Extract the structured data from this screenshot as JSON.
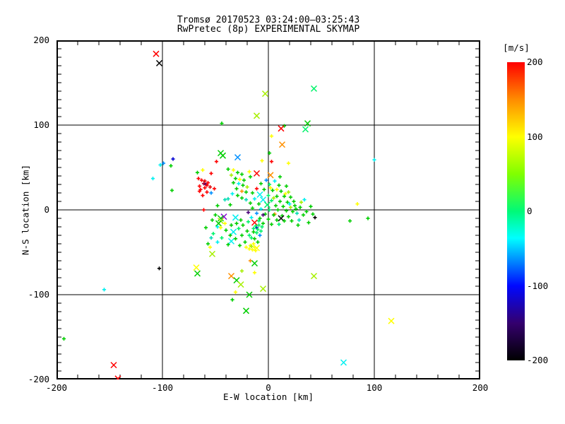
{
  "title": {
    "line1": "Tromsø 20170523 03:24:00–03:25:43",
    "line2": "RwPretec (8p) EXPERIMENTAL SKYMAP"
  },
  "axes": {
    "x_label": "E-W location [km]",
    "y_label": "N-S location [km]",
    "x_ticks": [
      "-200",
      "-100",
      "0",
      "100",
      "200"
    ],
    "y_ticks": [
      "200",
      "100",
      "0",
      "-100",
      "-200"
    ]
  },
  "colorbar": {
    "title": "[m/s]",
    "tick_labels": [
      "200",
      "100",
      "0",
      "-100",
      "-200"
    ],
    "min": -200,
    "max": 200,
    "stops": [
      {
        "pos": 0,
        "color": "#FF0000"
      },
      {
        "pos": 12.5,
        "color": "#FF8C00"
      },
      {
        "pos": 25,
        "color": "#FFFF00"
      },
      {
        "pos": 37.5,
        "color": "#80FF00"
      },
      {
        "pos": 50,
        "color": "#00FA78"
      },
      {
        "pos": 59,
        "color": "#00FFFF"
      },
      {
        "pos": 75,
        "color": "#0008FF"
      },
      {
        "pos": 87.5,
        "color": "#34006E"
      },
      {
        "pos": 100,
        "color": "#000000"
      }
    ]
  },
  "chart_data": {
    "type": "scatter",
    "title": "Tromsø 20170523 03:24:00–03:25:43 / RwPretec (8p) EXPERIMENTAL SKYMAP",
    "xlabel": "E-W location [km]",
    "ylabel": "N-S location [km]",
    "xlim": [
      -200,
      200
    ],
    "ylim": [
      -200,
      200
    ],
    "x_minor_tick": 20,
    "y_minor_tick": 10,
    "gridlines": [
      -100,
      0,
      100
    ],
    "grid": "on",
    "legend_position": "right-colorbar",
    "color_units": "m/s",
    "palette": {
      "red": "#FF0000",
      "crimson": "#E00000",
      "maroon": "#A8002E",
      "orange": "#FF9000",
      "yellow": "#FFFF00",
      "chartreuse": "#A6F000",
      "green": "#00CE00",
      "spring": "#00F36A",
      "teal": "#00DCB4",
      "cyan": "#00F0F0",
      "skyblue": "#0090FF",
      "navy": "#0000D2",
      "purple": "#8800D8",
      "darkpurple": "#48007A",
      "black": "#000000"
    },
    "marker_legend": {
      "p": "small plus",
      "x": "large cross"
    },
    "points": [
      [
        -106,
        184,
        "red",
        "x"
      ],
      [
        -103,
        173,
        "black",
        "x"
      ],
      [
        43,
        143,
        "spring",
        "x"
      ],
      [
        -3,
        137,
        "chartreuse",
        "x"
      ],
      [
        -11,
        111,
        "chartreuse",
        "x"
      ],
      [
        -44,
        102,
        "green",
        "p"
      ],
      [
        37,
        102,
        "green",
        "x"
      ],
      [
        15,
        99,
        "green",
        "p"
      ],
      [
        12,
        96,
        "red",
        "x"
      ],
      [
        35,
        95,
        "spring",
        "x"
      ],
      [
        3,
        87,
        "yellow",
        "p"
      ],
      [
        13,
        77,
        "orange",
        "x"
      ],
      [
        100,
        59,
        "cyan",
        "p"
      ],
      [
        84,
        7,
        "yellow",
        "p"
      ],
      [
        94,
        -10,
        "green",
        "p"
      ],
      [
        77,
        -13,
        "green",
        "p"
      ],
      [
        44,
        -9,
        "black",
        "p"
      ],
      [
        -155,
        -94,
        "cyan",
        "p"
      ],
      [
        -193,
        -152,
        "green",
        "p"
      ],
      [
        -146,
        -183,
        "red",
        "x"
      ],
      [
        -142,
        -199,
        "red",
        "x"
      ],
      [
        43,
        -78,
        "chartreuse",
        "x"
      ],
      [
        116,
        -131,
        "yellow",
        "x"
      ],
      [
        71,
        -180,
        "cyan",
        "x"
      ],
      [
        -103,
        -69,
        "black",
        "p"
      ],
      [
        -45,
        67,
        "green",
        "x"
      ],
      [
        -90,
        60,
        "navy",
        "p"
      ],
      [
        -102,
        53,
        "cyan",
        "p"
      ],
      [
        -99,
        55,
        "skyblue",
        "p"
      ],
      [
        -92,
        52,
        "green",
        "p"
      ],
      [
        -109,
        37,
        "cyan",
        "p"
      ],
      [
        -91,
        23,
        "green",
        "p"
      ],
      [
        -49,
        57,
        "red",
        "p"
      ],
      [
        -43,
        64,
        "green",
        "x"
      ],
      [
        -29,
        62,
        "skyblue",
        "x"
      ],
      [
        -62,
        47,
        "yellow",
        "p"
      ],
      [
        -67,
        44,
        "green",
        "p"
      ],
      [
        -54,
        43,
        "red",
        "p"
      ],
      [
        -66,
        37,
        "red",
        "p"
      ],
      [
        -63,
        35,
        "red",
        "p"
      ],
      [
        -60,
        34,
        "crimson",
        "p"
      ],
      [
        -57,
        32,
        "red",
        "p"
      ],
      [
        -61,
        31,
        "maroon",
        "p"
      ],
      [
        -59,
        30,
        "darkpurple",
        "p"
      ],
      [
        -58,
        29,
        "red",
        "p"
      ],
      [
        -65,
        28,
        "red",
        "p"
      ],
      [
        -55,
        27,
        "crimson",
        "p"
      ],
      [
        -60,
        26,
        "red",
        "p"
      ],
      [
        -51,
        25,
        "red",
        "p"
      ],
      [
        -64,
        24,
        "red",
        "p"
      ],
      [
        -65,
        22,
        "red",
        "p"
      ],
      [
        -58,
        21,
        "red",
        "p"
      ],
      [
        -54,
        20,
        "skyblue",
        "p"
      ],
      [
        -62,
        17,
        "red",
        "p"
      ],
      [
        -38,
        48,
        "green",
        "p"
      ],
      [
        -33,
        47,
        "yellow",
        "p"
      ],
      [
        -18,
        45,
        "yellow",
        "p"
      ],
      [
        -29,
        44,
        "green",
        "p"
      ],
      [
        -11,
        43,
        "red",
        "x"
      ],
      [
        -25,
        42,
        "green",
        "p"
      ],
      [
        -35,
        41,
        "chartreuse",
        "p"
      ],
      [
        -17,
        39,
        "green",
        "p"
      ],
      [
        -31,
        37,
        "green",
        "p"
      ],
      [
        -27,
        36,
        "yellow",
        "p"
      ],
      [
        -23,
        35,
        "green",
        "p"
      ],
      [
        -33,
        32,
        "green",
        "p"
      ],
      [
        -28,
        31,
        "cyan",
        "p"
      ],
      [
        -24,
        29,
        "green",
        "p"
      ],
      [
        -20,
        27,
        "chartreuse",
        "p"
      ],
      [
        -30,
        25,
        "green",
        "p"
      ],
      [
        -25,
        22,
        "orange",
        "p"
      ],
      [
        -21,
        21,
        "green",
        "p"
      ],
      [
        -34,
        19,
        "cyan",
        "p"
      ],
      [
        -29,
        17,
        "green",
        "p"
      ],
      [
        -25,
        14,
        "green",
        "p"
      ],
      [
        -21,
        12,
        "teal",
        "p"
      ],
      [
        -41,
        12,
        "teal",
        "p"
      ],
      [
        -38,
        13,
        "teal",
        "p"
      ],
      [
        -6,
        58,
        "yellow",
        "p"
      ],
      [
        3,
        57,
        "red",
        "p"
      ],
      [
        19,
        55,
        "yellow",
        "p"
      ],
      [
        1,
        67,
        "green",
        "p"
      ],
      [
        2,
        41,
        "orange",
        "x"
      ],
      [
        11,
        39,
        "green",
        "p"
      ],
      [
        -2,
        35,
        "skyblue",
        "p"
      ],
      [
        6,
        34,
        "cyan",
        "p"
      ],
      [
        -7,
        31,
        "green",
        "p"
      ],
      [
        1,
        30,
        "spring",
        "p"
      ],
      [
        10,
        29,
        "green",
        "p"
      ],
      [
        17,
        28,
        "green",
        "p"
      ],
      [
        2,
        26,
        "yellow",
        "p"
      ],
      [
        -11,
        25,
        "red",
        "p"
      ],
      [
        -4,
        24,
        "green",
        "p"
      ],
      [
        8,
        24,
        "yellow",
        "p"
      ],
      [
        4,
        23,
        "green",
        "p"
      ],
      [
        12,
        22,
        "green",
        "p"
      ],
      [
        19,
        21,
        "chartreuse",
        "p"
      ],
      [
        -15,
        20,
        "green",
        "p"
      ],
      [
        16,
        19,
        "yellow",
        "p"
      ],
      [
        -8,
        18,
        "cyan",
        "x"
      ],
      [
        0,
        17,
        "spring",
        "p"
      ],
      [
        8,
        16,
        "green",
        "p"
      ],
      [
        15,
        16,
        "green",
        "p"
      ],
      [
        21,
        15,
        "green",
        "p"
      ],
      [
        5,
        14,
        "chartreuse",
        "p"
      ],
      [
        -13,
        13,
        "cyan",
        "p"
      ],
      [
        -5,
        12,
        "cyan",
        "x"
      ],
      [
        3,
        11,
        "spring",
        "p"
      ],
      [
        11,
        10,
        "green",
        "p"
      ],
      [
        24,
        10,
        "green",
        "p"
      ],
      [
        18,
        9,
        "green",
        "p"
      ],
      [
        31,
        9,
        "chartreuse",
        "p"
      ],
      [
        -17,
        8,
        "green",
        "p"
      ],
      [
        -9,
        7,
        "green",
        "p"
      ],
      [
        20,
        7,
        "cyan",
        "p"
      ],
      [
        -1,
        6,
        "spring",
        "x"
      ],
      [
        7,
        5,
        "green",
        "p"
      ],
      [
        25,
        5,
        "green",
        "p"
      ],
      [
        14,
        4,
        "green",
        "p"
      ],
      [
        40,
        4,
        "green",
        "p"
      ],
      [
        21,
        3,
        "chartreuse",
        "p"
      ],
      [
        30,
        3,
        "green",
        "p"
      ],
      [
        -15,
        2,
        "green",
        "p"
      ],
      [
        26,
        1,
        "green",
        "p"
      ],
      [
        -7,
        1,
        "cyan",
        "p"
      ],
      [
        1,
        0,
        "spring",
        "p"
      ],
      [
        9,
        0,
        "green",
        "p"
      ],
      [
        17,
        -1,
        "green",
        "p"
      ],
      [
        23,
        -2,
        "green",
        "p"
      ],
      [
        36,
        -2,
        "green",
        "p"
      ],
      [
        -19,
        -3,
        "darkpurple",
        "p"
      ],
      [
        -11,
        -4,
        "skyblue",
        "p"
      ],
      [
        27,
        -4,
        "teal",
        "p"
      ],
      [
        -3,
        -5,
        "green",
        "p"
      ],
      [
        6,
        -5,
        "orange",
        "p"
      ],
      [
        42,
        -5,
        "green",
        "p"
      ],
      [
        5,
        -6,
        "green",
        "p"
      ],
      [
        -5,
        -6,
        "darkpurple",
        "p"
      ],
      [
        33,
        -6,
        "green",
        "p"
      ],
      [
        13,
        -7,
        "green",
        "p"
      ],
      [
        19,
        -8,
        "green",
        "p"
      ],
      [
        -16,
        -9,
        "cyan",
        "p"
      ],
      [
        -8,
        -10,
        "green",
        "p"
      ],
      [
        12,
        -10,
        "black",
        "x"
      ],
      [
        0,
        -11,
        "green",
        "p"
      ],
      [
        8,
        -12,
        "green",
        "p"
      ],
      [
        29,
        -12,
        "teal",
        "p"
      ],
      [
        15,
        -13,
        "green",
        "p"
      ],
      [
        22,
        -13,
        "green",
        "p"
      ],
      [
        -13,
        -15,
        "red",
        "x"
      ],
      [
        34,
        12,
        "cyan",
        "p"
      ],
      [
        -5,
        -16,
        "green",
        "p"
      ],
      [
        3,
        -17,
        "green",
        "p"
      ],
      [
        10,
        -17,
        "spring",
        "p"
      ],
      [
        38,
        -15,
        "green",
        "p"
      ],
      [
        28,
        -18,
        "green",
        "p"
      ],
      [
        -61,
        0,
        "red",
        "p"
      ],
      [
        -50,
        -6,
        "green",
        "p"
      ],
      [
        -48,
        5,
        "green",
        "p"
      ],
      [
        -36,
        6,
        "green",
        "p"
      ],
      [
        -42,
        -8,
        "purple",
        "x"
      ],
      [
        -31,
        -9,
        "cyan",
        "x"
      ],
      [
        -45,
        -10,
        "green",
        "x"
      ],
      [
        -53,
        -12,
        "green",
        "p"
      ],
      [
        -45,
        -13,
        "chartreuse",
        "x"
      ],
      [
        -47,
        -16,
        "green",
        "x"
      ],
      [
        -59,
        -21,
        "green",
        "p"
      ],
      [
        -45,
        -21,
        "yellow",
        "p"
      ],
      [
        -48,
        -20,
        "cyan",
        "p"
      ],
      [
        -41,
        -16,
        "yellow",
        "p"
      ],
      [
        -33,
        -26,
        "cyan",
        "x"
      ],
      [
        -35,
        -37,
        "cyan",
        "x"
      ],
      [
        -38,
        -41,
        "green",
        "p"
      ],
      [
        -54,
        -33,
        "teal",
        "p"
      ],
      [
        -48,
        -38,
        "cyan",
        "p"
      ],
      [
        -52,
        -28,
        "spring",
        "p"
      ],
      [
        -44,
        -33,
        "spring",
        "p"
      ],
      [
        -57,
        -40,
        "green",
        "p"
      ],
      [
        -55,
        -44,
        "yellow",
        "p"
      ],
      [
        -53,
        -52,
        "chartreuse",
        "x"
      ],
      [
        -68,
        -68,
        "yellow",
        "x"
      ],
      [
        -67,
        -75,
        "green",
        "x"
      ],
      [
        -30,
        -16,
        "green",
        "p"
      ],
      [
        -26,
        -12,
        "green",
        "p"
      ],
      [
        -24,
        -18,
        "green",
        "p"
      ],
      [
        -19,
        -14,
        "spring",
        "p"
      ],
      [
        -35,
        -18,
        "green",
        "p"
      ],
      [
        -40,
        -24,
        "green",
        "p"
      ],
      [
        -20,
        -25,
        "green",
        "p"
      ],
      [
        -28,
        -22,
        "spring",
        "p"
      ],
      [
        -25,
        -30,
        "green",
        "p"
      ],
      [
        -36,
        -30,
        "green",
        "p"
      ],
      [
        -31,
        -34,
        "green",
        "p"
      ],
      [
        -16,
        -33,
        "spring",
        "p"
      ],
      [
        -22,
        -38,
        "green",
        "p"
      ],
      [
        -14,
        -26,
        "green",
        "p"
      ],
      [
        -18,
        -30,
        "spring",
        "p"
      ],
      [
        -13,
        -34,
        "green",
        "p"
      ],
      [
        -10,
        -38,
        "green",
        "p"
      ],
      [
        -27,
        -42,
        "green",
        "p"
      ],
      [
        -11,
        -21,
        "navy",
        "p"
      ],
      [
        -8,
        -30,
        "skyblue",
        "p"
      ],
      [
        -9,
        -18,
        "spring",
        "p"
      ],
      [
        -12,
        -19,
        "spring",
        "p"
      ],
      [
        -10,
        -23,
        "spring",
        "p"
      ],
      [
        -7,
        -25,
        "spring",
        "p"
      ],
      [
        -14,
        -22,
        "spring",
        "p"
      ],
      [
        -11,
        -27,
        "spring",
        "p"
      ],
      [
        -9,
        -13,
        "spring",
        "p"
      ],
      [
        -6,
        -20,
        "spring",
        "p"
      ],
      [
        -21,
        -44,
        "yellow",
        "p"
      ],
      [
        -17,
        -42,
        "yellow",
        "p"
      ],
      [
        -13,
        -44,
        "yellow",
        "p"
      ],
      [
        -15,
        -47,
        "yellow",
        "p"
      ],
      [
        -18,
        -46,
        "yellow",
        "p"
      ],
      [
        -12,
        -48,
        "yellow",
        "p"
      ],
      [
        -16,
        -43,
        "chartreuse",
        "p"
      ],
      [
        -14,
        -40,
        "yellow",
        "p"
      ],
      [
        -11,
        -45,
        "yellow",
        "x"
      ],
      [
        -17,
        -60,
        "orange",
        "p"
      ],
      [
        -13,
        -63,
        "green",
        "x"
      ],
      [
        -25,
        -72,
        "chartreuse",
        "p"
      ],
      [
        -13,
        -74,
        "yellow",
        "p"
      ],
      [
        -35,
        -78,
        "orange",
        "x"
      ],
      [
        -30,
        -83,
        "green",
        "x"
      ],
      [
        -26,
        -88,
        "chartreuse",
        "x"
      ],
      [
        -5,
        -93,
        "chartreuse",
        "x"
      ],
      [
        -31,
        -97,
        "yellow",
        "p"
      ],
      [
        -18,
        -100,
        "green",
        "x"
      ],
      [
        -34,
        -106,
        "green",
        "p"
      ],
      [
        -21,
        -119,
        "green",
        "x"
      ]
    ]
  }
}
